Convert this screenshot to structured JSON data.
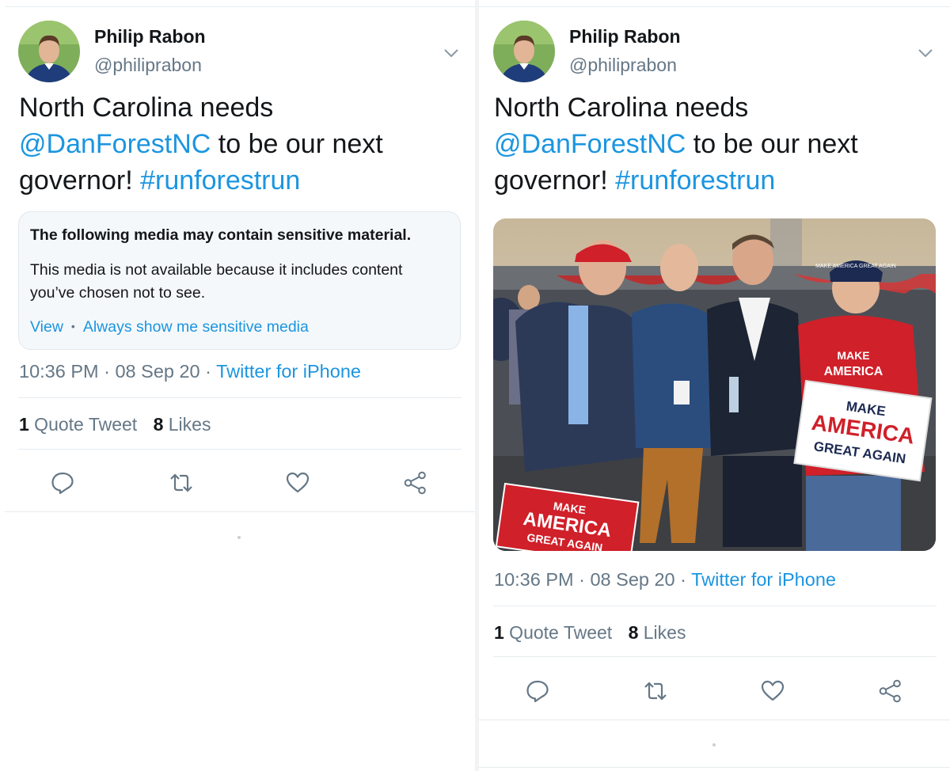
{
  "tweet": {
    "display_name": "Philip Rabon",
    "handle": "@philiprabon",
    "text_line1": "North Carolina needs",
    "mention": "@DanForestNC",
    "text_after_mention": " to be our next",
    "text_line3_start": "governor! ",
    "hashtag": "#runforestrun",
    "time_date": "10:36 PM · 08 Sep 20 · ",
    "source": "Twitter for iPhone",
    "quote_count": "1",
    "quote_label": " Quote Tweet",
    "like_count": "8",
    "like_label": " Likes"
  },
  "sensitive": {
    "title": "The following media may contain sensitive material.",
    "description": "This media is not available because it includes content you’ve chosen not to see.",
    "view": "View",
    "separator": "•",
    "always_show": "Always show me sensitive media"
  },
  "photo": {
    "hat_text": "MAKE AMERICA GREAT AGAIN",
    "shirt_line1": "MAKE",
    "shirt_line2": "AMERICA",
    "white_sign_line1": "MAKE",
    "white_sign_line2": "AMERICA",
    "white_sign_line3": "GREAT AGAIN",
    "red_sign_line1": "MAKE",
    "red_sign_line2": "AMERICA",
    "red_sign_line3": "GREAT AGAIN"
  },
  "icons": [
    "chevron-down-icon",
    "reply-icon",
    "retweet-icon",
    "like-icon",
    "share-icon"
  ],
  "colors": {
    "link": "#1b95e0",
    "secondary": "#657786",
    "maga_red": "#d0202a"
  }
}
